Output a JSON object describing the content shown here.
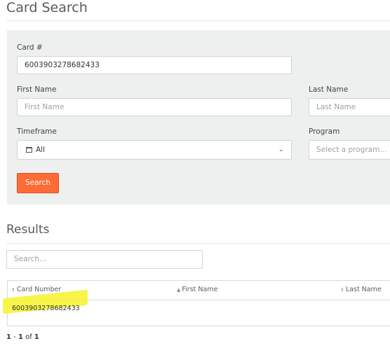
{
  "page": {
    "title": "Card Search"
  },
  "search_form": {
    "card_label": "Card #",
    "card_value": "6003903278682433",
    "first_name_label": "First Name",
    "first_name_placeholder": "First Name",
    "last_name_label": "Last Name",
    "last_name_placeholder": "Last Name",
    "timeframe_label": "Timeframe",
    "timeframe_value": "All",
    "program_label": "Program",
    "program_placeholder": "Select a program...",
    "search_button": "Search",
    "button_color": "#ff6b35"
  },
  "results": {
    "title": "Results",
    "search_placeholder": "Search...",
    "columns": [
      {
        "label": "Card Number",
        "sort_icon": "sort-icon"
      },
      {
        "label": "First Name",
        "sort_icon": "sort-asc-icon"
      },
      {
        "label": "Last Name",
        "sort_icon": "sort-icon"
      }
    ],
    "rows": [
      {
        "card_number": "6003903278682433",
        "first_name": "",
        "last_name": ""
      }
    ],
    "pagination": {
      "start": "1",
      "end": "1",
      "total": "1"
    }
  }
}
